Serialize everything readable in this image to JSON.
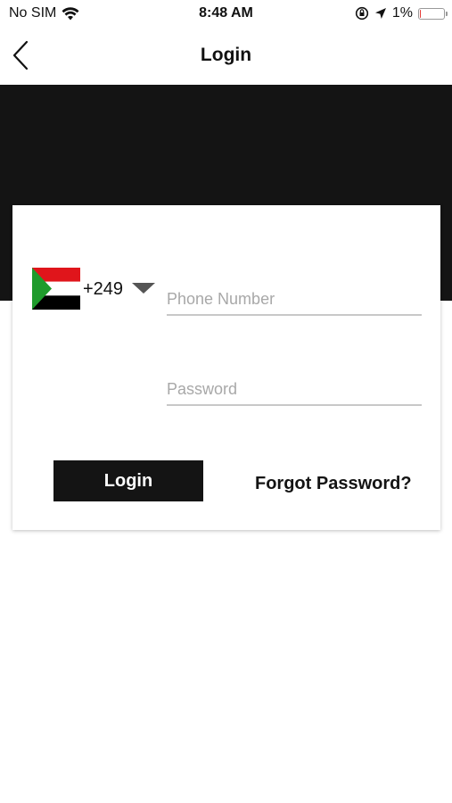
{
  "status_bar": {
    "carrier": "No SIM",
    "time": "8:48 AM",
    "battery_percent_label": "1%",
    "battery_level": 0.01,
    "icons": [
      "wifi-icon",
      "orientation-lock-icon",
      "location-arrow-icon",
      "battery-icon"
    ]
  },
  "nav": {
    "title": "Login",
    "back_icon": "chevron-left-icon"
  },
  "login_form": {
    "country": {
      "flag": "sudan-flag",
      "dial_code": "+249",
      "dropdown_icon": "caret-down-icon"
    },
    "phone": {
      "placeholder": "Phone Number",
      "value": ""
    },
    "password": {
      "placeholder": "Password",
      "value": ""
    },
    "login_label": "Login",
    "forgot_label": "Forgot Password?"
  },
  "colors": {
    "hero_background": "#141414",
    "button_background": "#141414",
    "flag_red": "#e0151b",
    "flag_white": "#ffffff",
    "flag_black": "#000000",
    "flag_green": "#1f9b2c"
  }
}
